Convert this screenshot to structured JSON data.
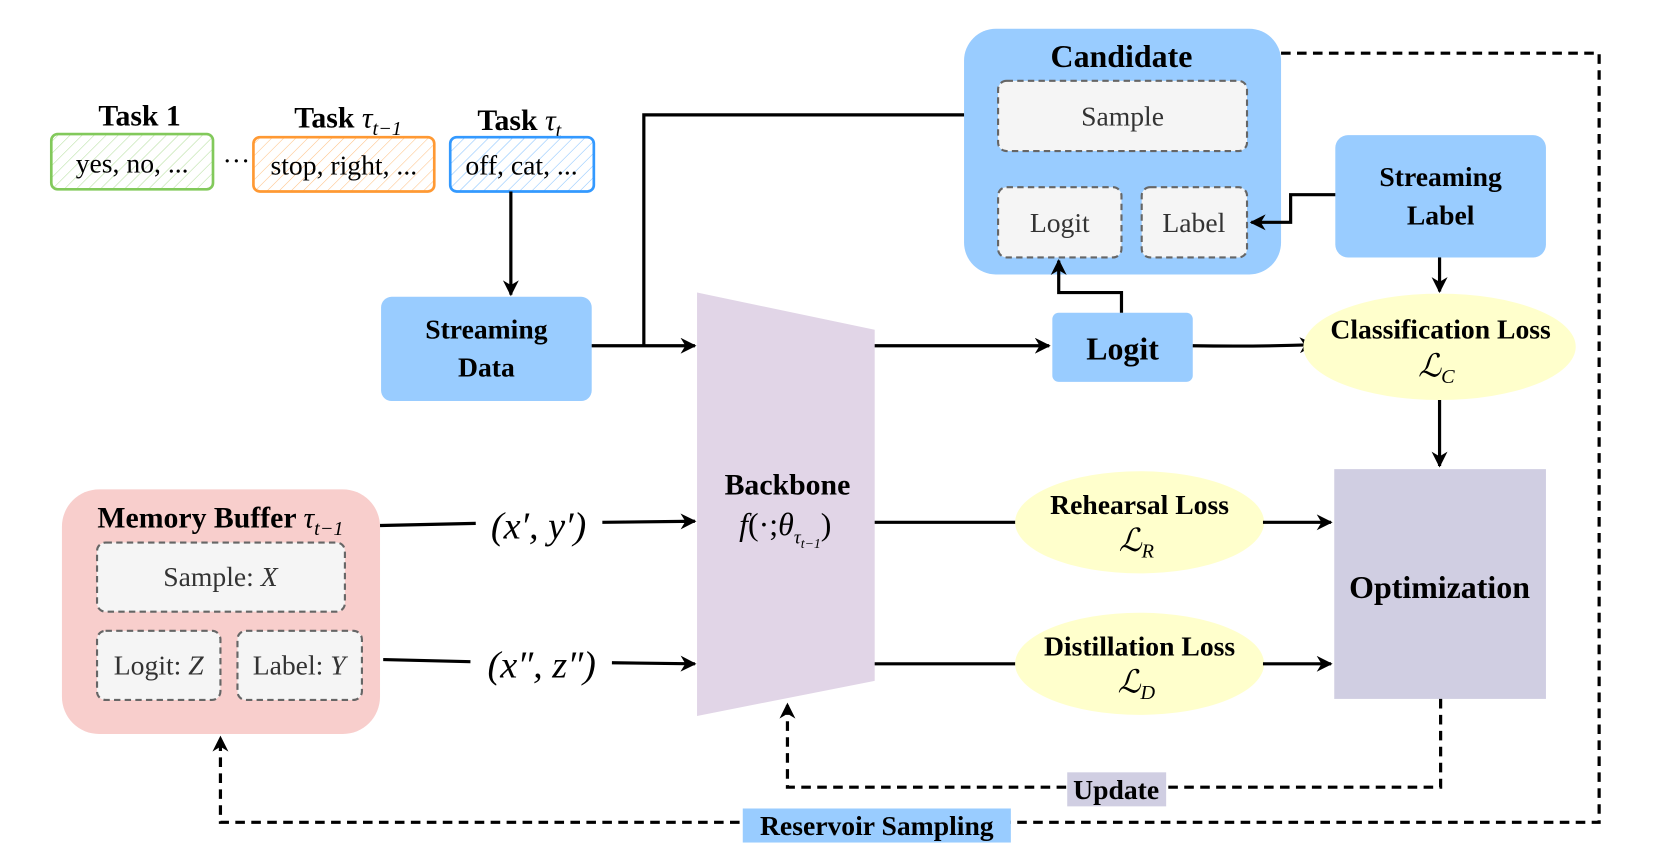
{
  "colors": {
    "blue_box": "#99ccff",
    "memory_buffer": "#f8cecc",
    "backbone": "#e1d5e7",
    "optimization": "#d0cee2",
    "loss_ellipse": "#ffffcc",
    "inner_box": "#f5f5f5",
    "task1": "#82c95b",
    "task_prev": "#ff9933",
    "task_cur": "#3399ff"
  },
  "tasks": [
    {
      "title": "Task 1",
      "sub": "",
      "words": "yes, no, ..."
    },
    {
      "title": "Task ",
      "sym": "τ",
      "sub": "t−1",
      "words": "stop, right, ..."
    },
    {
      "title": "Task ",
      "sym": "τ",
      "sub": "t",
      "words": "off, cat, ..."
    }
  ],
  "ellipsis": "···",
  "streaming_data": {
    "line1": "Streaming",
    "line2": "Data"
  },
  "candidate": {
    "title": "Candidate",
    "sample": "Sample",
    "logit": "Logit",
    "label": "Label"
  },
  "streaming_label": {
    "line1": "Streaming",
    "line2": "Label"
  },
  "logit": "Logit",
  "backbone": {
    "title": "Backbone",
    "f": "f",
    "args": "(·;",
    "theta": "θ",
    "tau": "τ",
    "sub": "t−1",
    "close": ")"
  },
  "losses": {
    "classification": {
      "name": "Classification Loss",
      "sym": "ℒ",
      "sub": "C"
    },
    "rehearsal": {
      "name": "Rehearsal Loss",
      "sym": "ℒ",
      "sub": "R"
    },
    "distillation": {
      "name": "Distillation Loss",
      "sym": "ℒ",
      "sub": "D"
    }
  },
  "optimization": "Optimization",
  "memory_buffer": {
    "title": "Memory Buffer ",
    "sym": "τ",
    "sub": "t−1",
    "sample": "Sample: ",
    "sample_var": "X",
    "logit": "Logit: ",
    "logit_var": "Z",
    "label": "Label: ",
    "label_var": "Y"
  },
  "pairs": {
    "first": "(x′, y′)",
    "second": "(x″, z″)"
  },
  "update": "Update",
  "reservoir": "Reservoir Sampling"
}
